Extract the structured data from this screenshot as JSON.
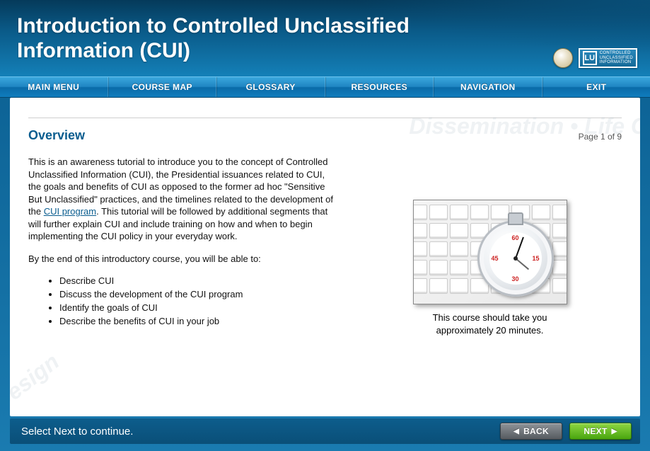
{
  "header": {
    "title": "Introduction to Controlled Unclassified Information (CUI)",
    "badge_initials": "LU",
    "badge_lines": [
      "Controlled",
      "Unclassified",
      "Information"
    ]
  },
  "nav": {
    "items": [
      "MAIN MENU",
      "COURSE MAP",
      "GLOSSARY",
      "RESOURCES",
      "NAVIGATION",
      "EXIT"
    ]
  },
  "page": {
    "heading": "Overview",
    "counter": "Page 1 of 9",
    "watermark_top": "Dissemination • Life C",
    "watermark_left": "Design",
    "paragraph1_a": "This is an awareness tutorial to introduce you to the concept of Controlled Unclassified Information (CUI), the Presidential issuances related to CUI, the goals and benefits of CUI as opposed to the former ad hoc \"Sensitive But Unclassified\" practices, and the timelines related to the development of the ",
    "link_text": "CUI program",
    "paragraph1_b": ".  This tutorial will be followed by additional segments that will further explain CUI and include training on how and when to begin implementing the CUI policy in your everyday work.",
    "paragraph2": "By the end of this introductory course, you will be able to:",
    "objectives": [
      "Describe CUI",
      "Discuss the development of the CUI program",
      "Identify the goals of CUI",
      "Describe the benefits of CUI in your job"
    ],
    "image_caption": "This course should take you approximately 20 minutes.",
    "stopwatch_numbers": {
      "top": "60",
      "right": "15",
      "bottom": "30",
      "left": "45"
    }
  },
  "footer": {
    "prompt": "Select Next to continue.",
    "back_label": "BACK",
    "next_label": "NEXT"
  }
}
